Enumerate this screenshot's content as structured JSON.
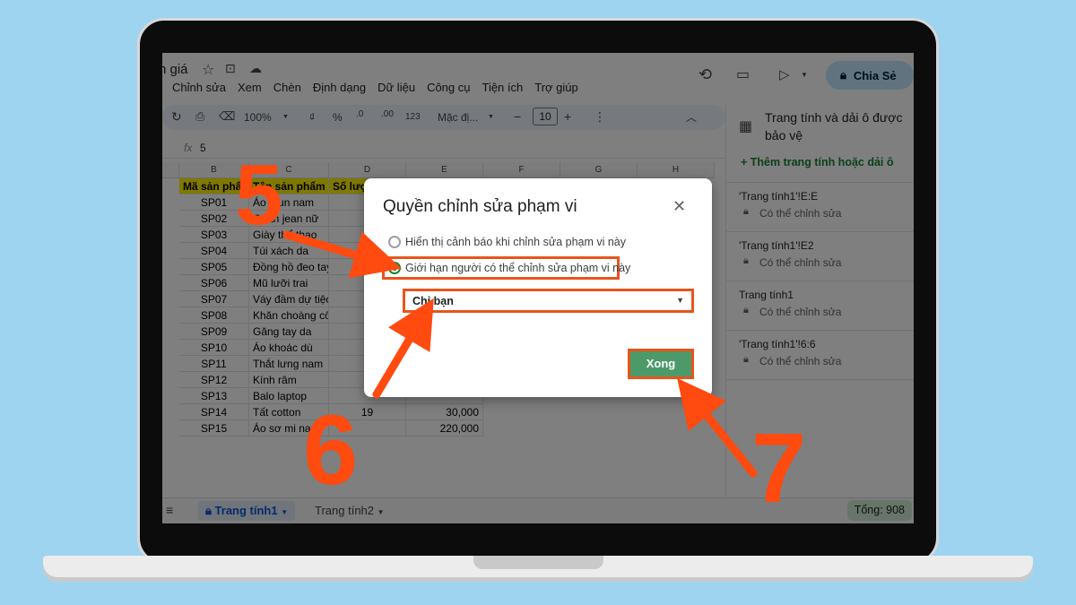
{
  "doc": {
    "title_fragment": "n giá"
  },
  "menu": [
    "Chỉnh sửa",
    "Xem",
    "Chèn",
    "Định dạng",
    "Dữ liệu",
    "Công cụ",
    "Tiện ích",
    "Trợ giúp"
  ],
  "header": {
    "share_label": "Chia Sẻ"
  },
  "toolbar": {
    "zoom": "100%",
    "currency": "₫",
    "percent": "%",
    "dec_decrease": ".0",
    "dec_increase": ".00",
    "number_format": "123",
    "font": "Mặc đị...",
    "font_size": "10"
  },
  "formula": {
    "fx": "fx",
    "value": "5"
  },
  "columns": [
    "B",
    "C",
    "D",
    "E",
    "F",
    "G",
    "H"
  ],
  "table": {
    "headers": [
      "Mã sản phẩm",
      "Tên sản phẩm",
      "Số lượng"
    ],
    "rows": [
      {
        "code": "SP01",
        "name": "Áo thun nam",
        "qty": "",
        "price": ""
      },
      {
        "code": "SP02",
        "name": "Quần jean nữ",
        "qty": "",
        "price": ""
      },
      {
        "code": "SP03",
        "name": "Giày thể thao",
        "qty": "",
        "price": ""
      },
      {
        "code": "SP04",
        "name": "Túi xách da",
        "qty": "",
        "price": ""
      },
      {
        "code": "SP05",
        "name": "Đồng hồ đeo tay",
        "qty": "",
        "price": ""
      },
      {
        "code": "SP06",
        "name": "Mũ lưỡi trai",
        "qty": "",
        "price": ""
      },
      {
        "code": "SP07",
        "name": "Váy đầm dự tiệc",
        "qty": "",
        "price": ""
      },
      {
        "code": "SP08",
        "name": "Khăn choàng cổ",
        "qty": "",
        "price": ""
      },
      {
        "code": "SP09",
        "name": "Găng tay da",
        "qty": "",
        "price": ""
      },
      {
        "code": "SP10",
        "name": "Áo khoác dù",
        "qty": "",
        "price": ""
      },
      {
        "code": "SP11",
        "name": "Thắt lưng nam",
        "qty": "",
        "price": ""
      },
      {
        "code": "SP12",
        "name": "Kính râm",
        "qty": "",
        "price": ""
      },
      {
        "code": "SP13",
        "name": "Balo laptop",
        "qty": "",
        "price": ""
      },
      {
        "code": "SP14",
        "name": "Tất cotton",
        "qty": "19",
        "price": "30,000"
      },
      {
        "code": "SP15",
        "name": "Áo sơ mi nam",
        "qty": "",
        "price": "220,000"
      }
    ]
  },
  "sheets": {
    "tab1": "Trang tính1",
    "tab2": "Trang tính2",
    "sum": "Tổng: 908"
  },
  "side_panel": {
    "title": "Trang tính và dải ô được bảo vệ",
    "add_label": "+ Thêm trang tính hoặc dải ô",
    "items": [
      {
        "range": "'Trang tính1'!E:E",
        "perm": "Có thể chỉnh sửa"
      },
      {
        "range": "'Trang tính1'!E2",
        "perm": "Có thể chỉnh sửa"
      },
      {
        "range": "Trang tính1",
        "perm": "Có thể chỉnh sửa"
      },
      {
        "range": "'Trang tính1'!6:6",
        "perm": "Có thể chỉnh sửa"
      }
    ]
  },
  "dialog": {
    "title": "Quyền chỉnh sửa phạm vi",
    "option_warning": "Hiển thị cảnh báo khi chỉnh sửa phạm vi này",
    "option_restrict": "Giới hạn người có thể chỉnh sửa phạm vi này",
    "select_value": "Chỉ bạn",
    "done_label": "Xong"
  },
  "annotations": {
    "step5": "5",
    "step6": "6",
    "step7": "7",
    "color": "#ff4a10"
  },
  "colors": {
    "share_bg": "#c2e7ff",
    "done_bg": "#4c9a69",
    "highlight": "#e8541c",
    "header_row": "#fff200"
  }
}
